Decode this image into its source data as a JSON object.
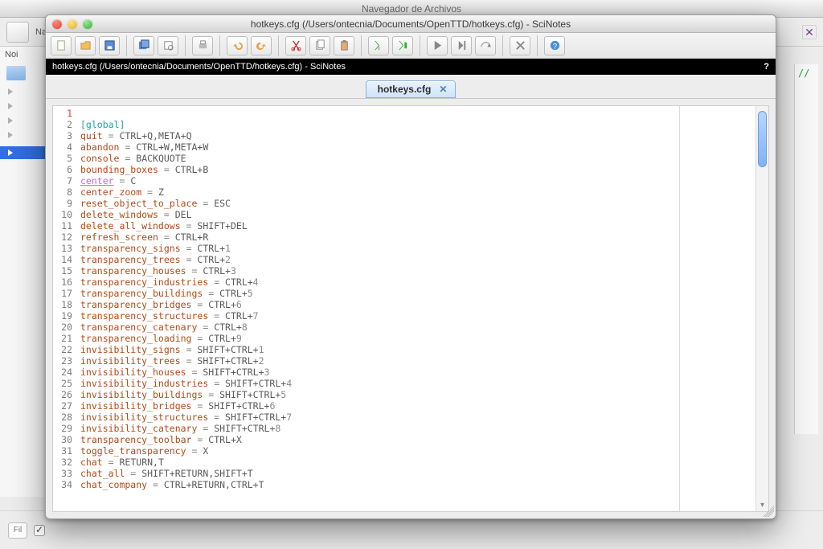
{
  "background": {
    "title": "Navegador de Archivos",
    "nav_label": "Nav",
    "noi_label": "Noi",
    "fil_label": "Fil",
    "slashes": "//"
  },
  "window": {
    "title": "hotkeys.cfg (/Users/ontecnia/Documents/OpenTTD/hotkeys.cfg) - SciNotes",
    "path_strip": "hotkeys.cfg (/Users/ontecnia/Documents/OpenTTD/hotkeys.cfg) - SciNotes",
    "help_glyph": "?",
    "tab_label": "hotkeys.cfg",
    "tab_close": "✕"
  },
  "toolbar_icons": [
    "new-file-icon",
    "open-file-icon",
    "save-icon",
    "save-all-icon",
    "print-preview-icon",
    "print-icon",
    "undo-icon",
    "redo-icon",
    "cut-icon",
    "copy-icon",
    "paste-icon",
    "run-icon",
    "run-to-icon",
    "play-icon",
    "step-icon",
    "step-over-icon",
    "preferences-icon",
    "help-icon"
  ],
  "code": {
    "lines": [
      {
        "n": 1,
        "raw": ""
      },
      {
        "n": 2,
        "section": "[global]"
      },
      {
        "n": 3,
        "name": "quit",
        "val": "CTRL+Q,META+Q"
      },
      {
        "n": 4,
        "name": "abandon",
        "val": "CTRL+W,META+W"
      },
      {
        "n": 5,
        "name": "console",
        "val": "BACKQUOTE"
      },
      {
        "n": 6,
        "name": "bounding_boxes",
        "val": "CTRL+B"
      },
      {
        "n": 7,
        "hlname": "center",
        "val": "C"
      },
      {
        "n": 8,
        "name": "center_zoom",
        "val": "Z"
      },
      {
        "n": 9,
        "name": "reset_object_to_place",
        "val": "ESC"
      },
      {
        "n": 10,
        "name": "delete_windows",
        "val": "DEL"
      },
      {
        "n": 11,
        "name": "delete_all_windows",
        "val": "SHIFT+DEL"
      },
      {
        "n": 12,
        "name": "refresh_screen",
        "val": "CTRL+R"
      },
      {
        "n": 13,
        "name": "transparency_signs",
        "val": "CTRL+",
        "num": "1"
      },
      {
        "n": 14,
        "name": "transparency_trees",
        "val": "CTRL+",
        "num": "2"
      },
      {
        "n": 15,
        "name": "transparency_houses",
        "val": "CTRL+",
        "num": "3"
      },
      {
        "n": 16,
        "name": "transparency_industries",
        "val": "CTRL+",
        "num": "4"
      },
      {
        "n": 17,
        "name": "transparency_buildings",
        "val": "CTRL+",
        "num": "5"
      },
      {
        "n": 18,
        "name": "transparency_bridges",
        "val": "CTRL+",
        "num": "6"
      },
      {
        "n": 19,
        "name": "transparency_structures",
        "val": "CTRL+",
        "num": "7"
      },
      {
        "n": 20,
        "name": "transparency_catenary",
        "val": "CTRL+",
        "num": "8"
      },
      {
        "n": 21,
        "name": "transparency_loading",
        "val": "CTRL+",
        "num": "9"
      },
      {
        "n": 22,
        "name": "invisibility_signs",
        "val": "SHIFT+CTRL+",
        "num": "1"
      },
      {
        "n": 23,
        "name": "invisibility_trees",
        "val": "SHIFT+CTRL+",
        "num": "2"
      },
      {
        "n": 24,
        "name": "invisibility_houses",
        "val": "SHIFT+CTRL+",
        "num": "3"
      },
      {
        "n": 25,
        "name": "invisibility_industries",
        "val": "SHIFT+CTRL+",
        "num": "4"
      },
      {
        "n": 26,
        "name": "invisibility_buildings",
        "val": "SHIFT+CTRL+",
        "num": "5"
      },
      {
        "n": 27,
        "name": "invisibility_bridges",
        "val": "SHIFT+CTRL+",
        "num": "6"
      },
      {
        "n": 28,
        "name": "invisibility_structures",
        "val": "SHIFT+CTRL+",
        "num": "7"
      },
      {
        "n": 29,
        "name": "invisibility_catenary",
        "val": "SHIFT+CTRL+",
        "num": "8"
      },
      {
        "n": 30,
        "name": "transparency_toolbar",
        "val": "CTRL+X"
      },
      {
        "n": 31,
        "name": "toggle_transparency",
        "val": "X"
      },
      {
        "n": 32,
        "name": "chat",
        "val": "RETURN,T"
      },
      {
        "n": 33,
        "name": "chat_all",
        "val": "SHIFT+RETURN,SHIFT+T"
      },
      {
        "n": 34,
        "name": "chat_company",
        "val": "CTRL+RETURN,CTRL+T"
      }
    ]
  }
}
